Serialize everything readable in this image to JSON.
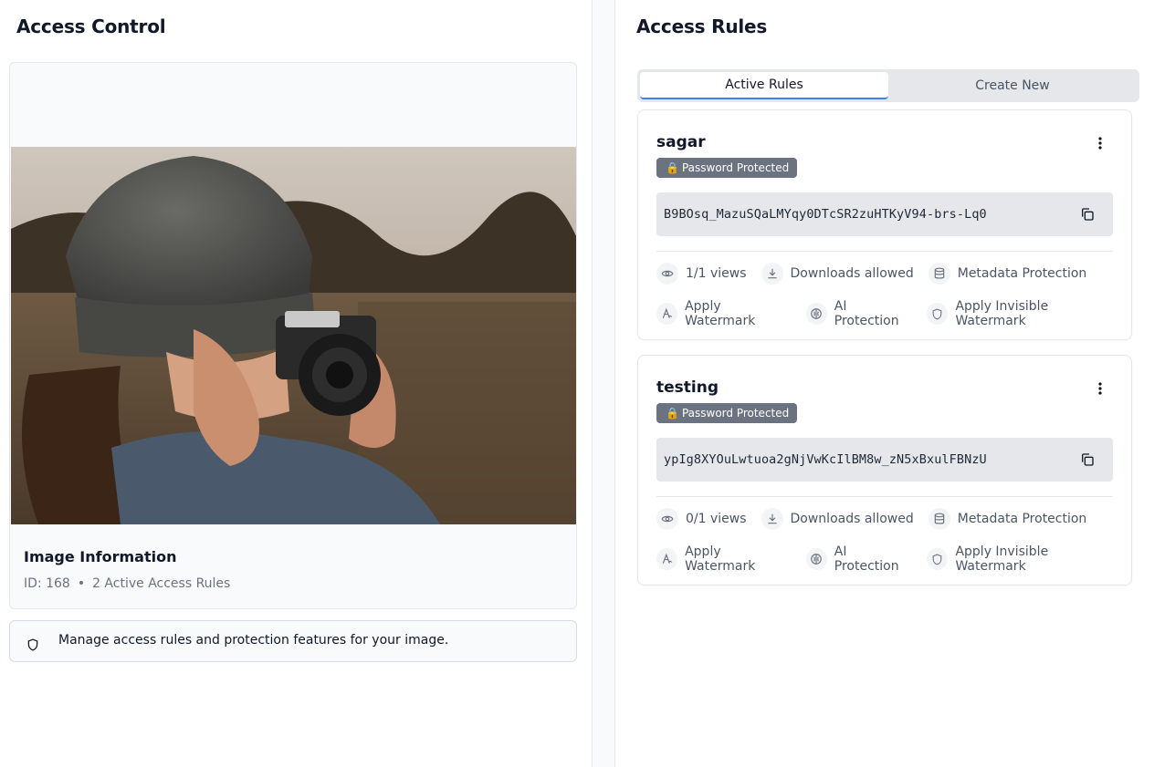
{
  "left": {
    "title": "Access Control",
    "image_info": {
      "title": "Image Information",
      "id_text": "ID: 168",
      "separator": "•",
      "rules_text": "2 Active Access Rules"
    },
    "notice": "Manage access rules and protection features for your image."
  },
  "right": {
    "title": "Access Rules",
    "tabs": [
      {
        "label": "Active Rules",
        "active": true
      },
      {
        "label": "Create New",
        "active": false
      }
    ],
    "rules": [
      {
        "name": "sagar",
        "badge": "Password Protected",
        "badge_icon": "lock-icon",
        "token": "B9BOsq_MazuSQaLMYqy0DTcSR2zuHTKyV94-brs-Lq0",
        "views": "1/1 views",
        "downloads": "Downloads allowed",
        "metadata": "Metadata Protection",
        "watermark": "Apply Watermark",
        "ai": "AI Protection",
        "invisible": "Apply Invisible Watermark"
      },
      {
        "name": "testing",
        "badge": "Password Protected",
        "badge_icon": "lock-icon",
        "token": "ypIg8XYOuLwtuoa2gNjVwKcIlBM8w_zN5xBxulFBNzU",
        "views": "0/1 views",
        "downloads": "Downloads allowed",
        "metadata": "Metadata Protection",
        "watermark": "Apply Watermark",
        "ai": "AI Protection",
        "invisible": "Apply Invisible Watermark"
      }
    ]
  },
  "colors": {
    "accent": "#3b82f6",
    "badge": "#6b7280",
    "token_bg": "#e5e7eb"
  }
}
